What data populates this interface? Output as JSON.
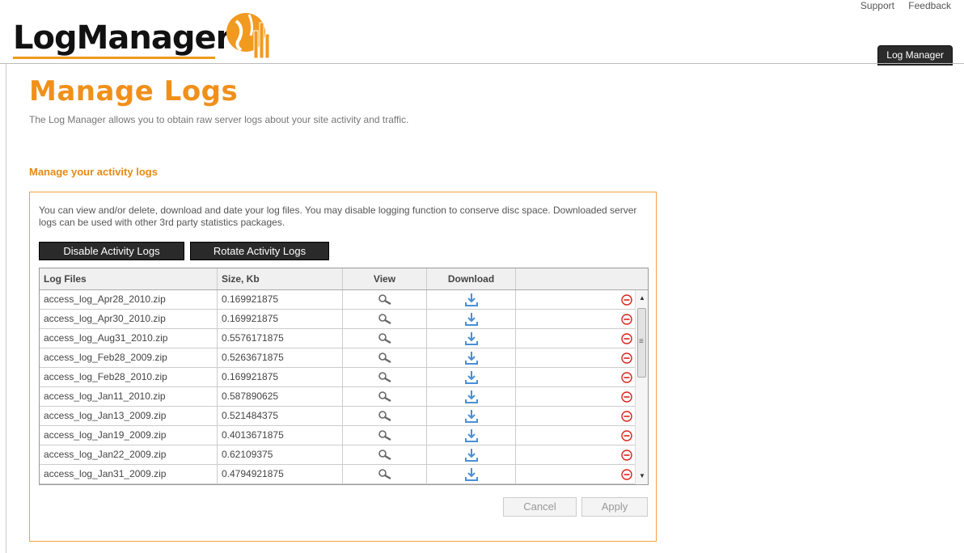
{
  "header": {
    "logo_text": "LogManager",
    "links": [
      "Support",
      "Feedback"
    ],
    "app_tab": "Log Manager"
  },
  "page": {
    "title": "Manage Logs",
    "description": "The Log Manager allows you to obtain raw server logs about your site activity and traffic.",
    "section_title": "Manage your activity logs"
  },
  "panel": {
    "description": "You can view and/or delete, download and date your log files. You may disable logging function to conserve disc space. Downloaded server logs can be used with other 3rd party statistics packages.",
    "disable_label": "Disable Activity Logs",
    "rotate_label": "Rotate Activity Logs",
    "cancel_label": "Cancel",
    "apply_label": "Apply"
  },
  "table": {
    "columns": [
      "Log Files",
      "Size, Kb",
      "View",
      "Download",
      ""
    ],
    "rows": [
      {
        "file": "access_log_Apr28_2010.zip",
        "size": "0.169921875"
      },
      {
        "file": "access_log_Apr30_2010.zip",
        "size": "0.169921875"
      },
      {
        "file": "access_log_Aug31_2010.zip",
        "size": "0.5576171875"
      },
      {
        "file": "access_log_Feb28_2009.zip",
        "size": "0.5263671875"
      },
      {
        "file": "access_log_Feb28_2010.zip",
        "size": "0.169921875"
      },
      {
        "file": "access_log_Jan11_2010.zip",
        "size": "0.587890625"
      },
      {
        "file": "access_log_Jan13_2009.zip",
        "size": "0.521484375"
      },
      {
        "file": "access_log_Jan19_2009.zip",
        "size": "0.4013671875"
      },
      {
        "file": "access_log_Jan22_2009.zip",
        "size": "0.62109375"
      },
      {
        "file": "access_log_Jan31_2009.zip",
        "size": "0.4794921875"
      }
    ]
  },
  "colors": {
    "accent": "#f0901a",
    "delete": "#d9231d",
    "download": "#4a8fd4"
  }
}
